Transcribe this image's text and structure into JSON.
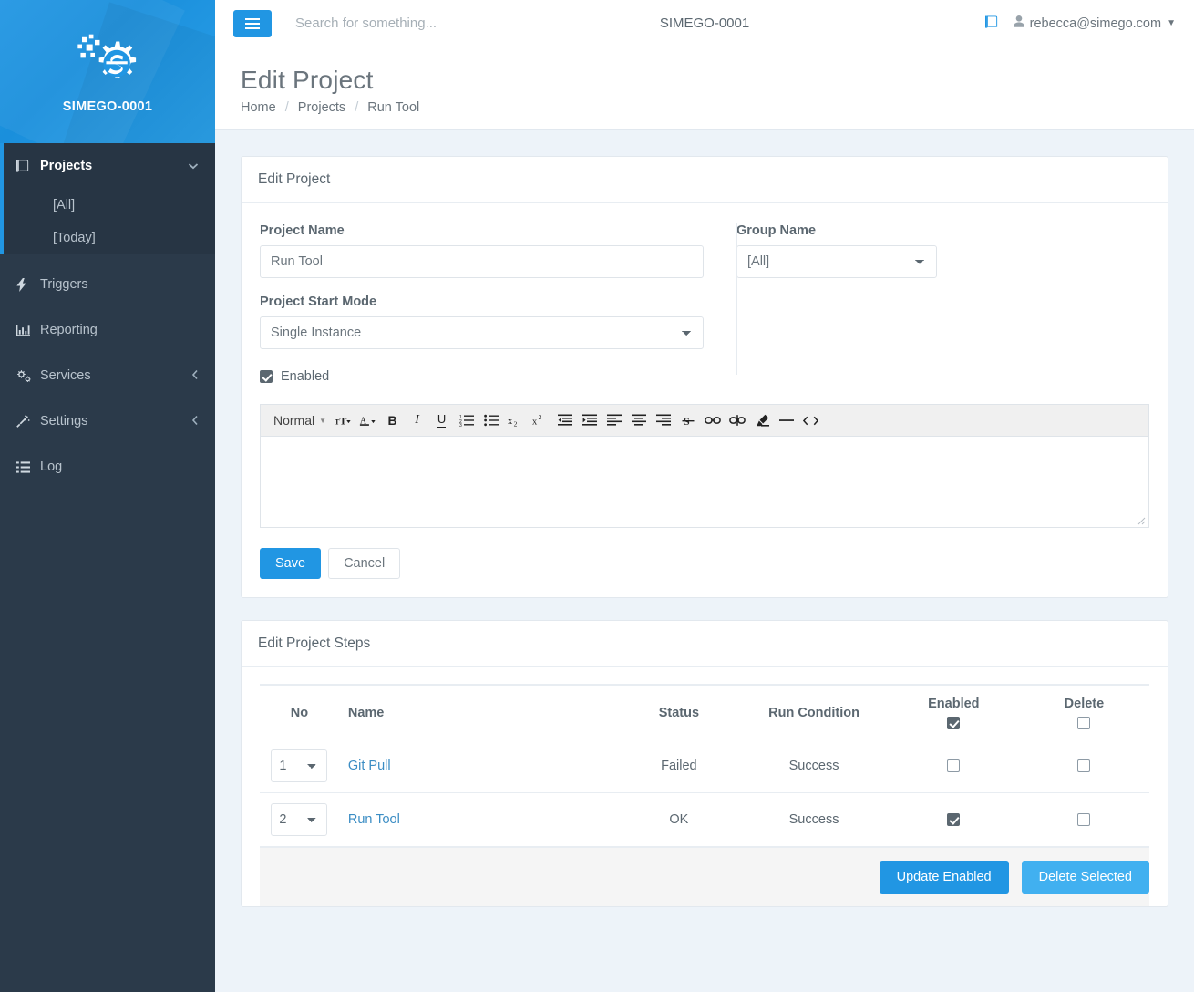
{
  "brand": {
    "name": "SIMEGO-0001",
    "logo_icon": "gear-s-logo-icon"
  },
  "sidebar": {
    "groups": [
      {
        "label": "Projects",
        "icon": "book-icon",
        "caret_icon": "chevron-down-icon",
        "children": [
          {
            "label": "[All]"
          },
          {
            "label": "[Today]"
          }
        ]
      }
    ],
    "items": [
      {
        "label": "Triggers",
        "icon": "bolt-icon",
        "caret": ""
      },
      {
        "label": "Reporting",
        "icon": "bar-chart-icon",
        "caret": ""
      },
      {
        "label": "Services",
        "icon": "gears-icon",
        "caret": "chevron-left-icon"
      },
      {
        "label": "Settings",
        "icon": "magic-wand-icon",
        "caret": "chevron-left-icon"
      },
      {
        "label": "Log",
        "icon": "list-icon",
        "caret": ""
      }
    ]
  },
  "topbar": {
    "menu_icon": "hamburger-icon",
    "search_placeholder": "Search for something...",
    "search_value": "",
    "center_title": "SIMEGO-0001",
    "docs_icon": "book-icon",
    "user_icon": "user-icon",
    "user_email": "rebecca@simego.com",
    "user_caret": "caret-down-icon"
  },
  "page": {
    "title": "Edit Project",
    "breadcrumb": [
      {
        "label": "Home"
      },
      {
        "label": "Projects"
      },
      {
        "label": "Run Tool"
      }
    ],
    "breadcrumb_separator": "/"
  },
  "edit_project": {
    "panel_title": "Edit Project",
    "project_name_label": "Project Name",
    "project_name_value": "Run Tool",
    "project_name_placeholder": "",
    "group_name_label": "Group Name",
    "group_name_value": "[All]",
    "start_mode_label": "Project Start Mode",
    "start_mode_value": "Single Instance",
    "enabled_label": "Enabled",
    "enabled_checked": true,
    "save_label": "Save",
    "cancel_label": "Cancel"
  },
  "editor": {
    "format_label": "Normal",
    "format_caret_icon": "caret-down-icon",
    "content": "",
    "tools": [
      {
        "name": "font-size-icon",
        "glyph": "ᴛT"
      },
      {
        "name": "font-color-icon",
        "glyph": "A"
      },
      {
        "name": "bold-icon",
        "glyph": "B"
      },
      {
        "name": "italic-icon",
        "glyph": "I"
      },
      {
        "name": "underline-icon",
        "glyph": "U"
      },
      {
        "name": "ordered-list-icon",
        "glyph": ""
      },
      {
        "name": "bullet-list-icon",
        "glyph": ""
      },
      {
        "name": "subscript-icon",
        "glyph": "x₂"
      },
      {
        "name": "superscript-icon",
        "glyph": "x²"
      },
      {
        "name": "outdent-icon",
        "glyph": ""
      },
      {
        "name": "indent-icon",
        "glyph": ""
      },
      {
        "name": "align-left-icon",
        "glyph": ""
      },
      {
        "name": "align-center-icon",
        "glyph": ""
      },
      {
        "name": "align-right-icon",
        "glyph": ""
      },
      {
        "name": "strikethrough-icon",
        "glyph": "S"
      },
      {
        "name": "link-icon",
        "glyph": ""
      },
      {
        "name": "unlink-icon",
        "glyph": ""
      },
      {
        "name": "clear-format-icon",
        "glyph": ""
      },
      {
        "name": "horizontal-rule-icon",
        "glyph": "—"
      },
      {
        "name": "code-block-icon",
        "glyph": "<>"
      }
    ]
  },
  "steps": {
    "panel_title": "Edit Project Steps",
    "columns": [
      "No",
      "Name",
      "Status",
      "Run Condition",
      "Enabled",
      "Delete"
    ],
    "header_enabled_checked": true,
    "header_delete_checked": false,
    "rows": [
      {
        "no": "1",
        "name": "Git Pull",
        "status": "Failed",
        "run_condition": "Success",
        "enabled": false,
        "delete": false
      },
      {
        "no": "2",
        "name": "Run Tool",
        "status": "OK",
        "run_condition": "Success",
        "enabled": true,
        "delete": false
      }
    ],
    "update_enabled_label": "Update Enabled",
    "delete_selected_label": "Delete Selected"
  },
  "colors": {
    "brand_blue": "#2196e3",
    "info_blue": "#41b0f0",
    "sidebar_dark": "#2b3a4a",
    "sidebar_group": "#273544",
    "content_bg": "#edf3f9",
    "link_blue": "#3b8dc4"
  }
}
